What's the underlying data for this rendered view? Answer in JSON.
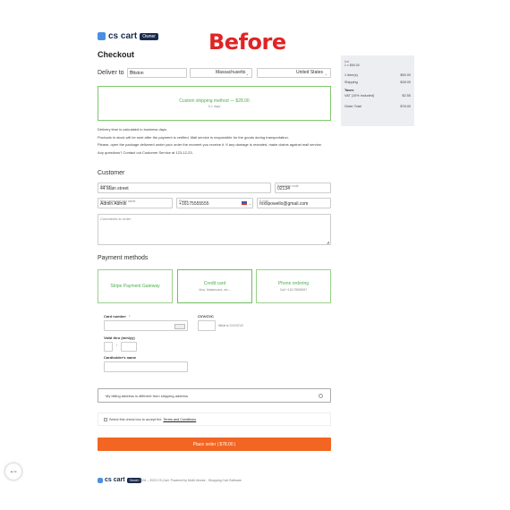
{
  "header": {
    "logo_text": "cs cart",
    "logo_badge": "Owner",
    "overlay_label": "Before"
  },
  "checkout": {
    "title": "Checkout",
    "deliver_to_label": "Deliver to",
    "city": {
      "label": "City",
      "value": "Boston"
    },
    "state": {
      "value": "Massachusetts"
    },
    "country": {
      "value": "United States"
    },
    "shipping_method": {
      "title": "Custom shipping method — $28.00",
      "subtitle": "0-1 days"
    },
    "notes": [
      "Delivery time is calculated in business days.",
      "Products in stock will be sent after the payment is verified. Mail service is responsible for the goods during transportation.",
      "Please, open the package delivered under your order the moment you receive it. If any damage is revealed, make claims against mail service.",
      "Any questions? Contact out Customer Service at 123-12-23."
    ]
  },
  "customer": {
    "title": "Customer",
    "address": {
      "label": "Address",
      "value": "44 Main street"
    },
    "postal": {
      "label": "Postal/zip code",
      "value": "02134"
    },
    "name": {
      "label": "First name and last name",
      "value": "Admin Admin"
    },
    "phone": {
      "label": "Phone",
      "value": "+16175555555"
    },
    "email": {
      "label": "E-mail",
      "value": "roxspowello@gmail.com"
    },
    "comments_placeholder": "Comments to order"
  },
  "payment": {
    "title": "Payment methods",
    "methods": [
      {
        "title": "Stripe Payment Gateway",
        "sub": ""
      },
      {
        "title": "Credit card",
        "sub": "Visa, Mastercard, etc..."
      },
      {
        "title": "Phone ordering",
        "sub": "Call +16175555557"
      }
    ],
    "card_number_label": "Card number",
    "cvv_label": "CVV/CVC",
    "cvv_help": "What is CVV/CVC",
    "valid_label": "Valid thru (mm/yy)",
    "valid_sep": "/",
    "holder_label": "Cardholder's name",
    "billing_diff_label": "My billing address is different from shipping address",
    "terms_text": "Select this check box to accept the",
    "terms_link": "Terms and Conditions",
    "place_order_label": "Place order | $78.00 |"
  },
  "summary": {
    "items_header": "Ind",
    "item_line": "1 × $50.00",
    "rows": [
      {
        "label": "1 item(s)",
        "value": "$50.00"
      },
      {
        "label": "Shipping",
        "value": "$28.00"
      }
    ],
    "taxes_label": "Taxes",
    "tax_row": {
      "label": "VAT (10% included)",
      "value": "$2.55"
    },
    "total_row": {
      "label": "Order Total",
      "value": "$78.00"
    }
  },
  "footer": {
    "logo_text": "cs cart",
    "logo_badge": "Owner",
    "copyright": "© 2004 – 2023 CS-Cart.  Powered by Multi-Vendor - Shopping Cart Software"
  },
  "floating": {
    "label": "▲ ▪▪▪"
  }
}
